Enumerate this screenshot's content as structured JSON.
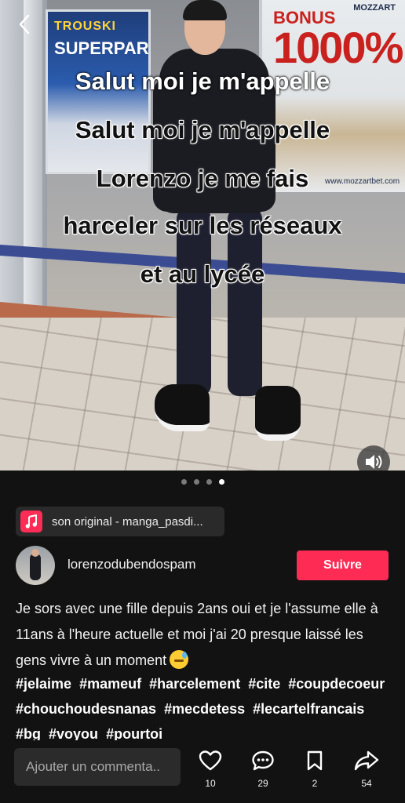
{
  "photo": {
    "caption_ghost": "Salut moi je m'appelle",
    "caption_lines": [
      "Salut moi je m'appelle",
      "Lorenzo je me fais",
      "harceler sur les réseaux",
      "et au lycée"
    ],
    "poster_left_line1": "TROUSKI",
    "poster_left_line2": "SUPERPAR",
    "poster_right_brand": "MOZZART",
    "poster_right_bonus": "BONUS",
    "poster_right_percent": "1000%",
    "poster_right_url": "www.mozzartbet.com",
    "carousel": {
      "total": 4,
      "active_index": 3
    }
  },
  "music": {
    "label": "son original - manga_pasdi..."
  },
  "profile": {
    "username": "lorenzodubendospam",
    "follow_label": "Suivre"
  },
  "description": {
    "text": "Je sors avec une fille depuis 2ans oui et je l'assume elle à 11ans à l'heure actuelle et moi j'ai 20 presque laissé les gens vivre à un moment",
    "hashtags": [
      "#jelaime",
      "#mameuf",
      "#harcelement",
      "#cite",
      "#coupdecoeur",
      "#chouchoudesnanas",
      "#mecdetess",
      "#lecartelfrancais",
      "#bg",
      "#voyou",
      "#pourtoi"
    ]
  },
  "bottom_bar": {
    "comment_placeholder": "Ajouter un commenta..",
    "likes": "10",
    "comments": "29",
    "saves": "2",
    "shares": "54"
  },
  "colors": {
    "background": "#121212",
    "accent": "#fe2c55",
    "pill": "#2a2a2a"
  },
  "icons": [
    "back-icon",
    "sound-on-icon",
    "music-note-icon",
    "heart-icon",
    "comment-icon",
    "bookmark-icon",
    "share-icon"
  ]
}
